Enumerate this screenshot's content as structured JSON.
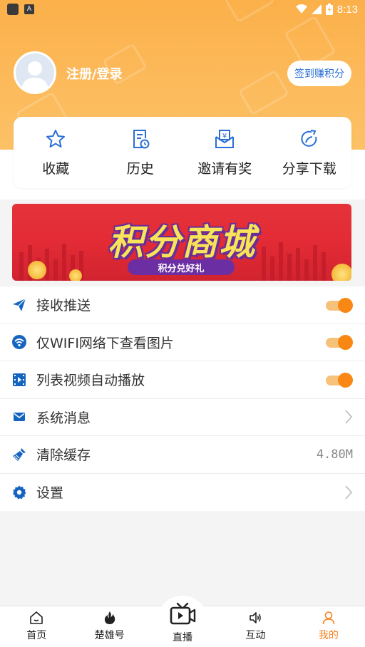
{
  "status_bar": {
    "time": "8:13"
  },
  "profile": {
    "login_text": "注册/登录",
    "checkin_button": "签到赚积分"
  },
  "quick_actions": [
    {
      "label": "收藏",
      "icon": "star-icon"
    },
    {
      "label": "历史",
      "icon": "history-icon"
    },
    {
      "label": "邀请有奖",
      "icon": "invite-icon"
    },
    {
      "label": "分享下载",
      "icon": "share-icon"
    }
  ],
  "banner": {
    "title": "积分商城",
    "subtitle": "积分兑好礼"
  },
  "settings": [
    {
      "label": "接收推送",
      "icon": "send-icon",
      "control": "toggle",
      "on": true
    },
    {
      "label": "仅WIFI网络下查看图片",
      "icon": "wifi-icon",
      "control": "toggle",
      "on": true
    },
    {
      "label": "列表视频自动播放",
      "icon": "video-icon",
      "control": "toggle",
      "on": true
    },
    {
      "label": "系统消息",
      "icon": "mail-icon",
      "control": "chevron"
    },
    {
      "label": "清除缓存",
      "icon": "broom-icon",
      "control": "value",
      "value": "4.80M"
    },
    {
      "label": "设置",
      "icon": "gear-icon",
      "control": "chevron"
    }
  ],
  "bottom_nav": [
    {
      "label": "首页",
      "icon": "home-icon"
    },
    {
      "label": "楚雄号",
      "icon": "fire-icon"
    },
    {
      "label": "直播",
      "icon": "live-tv-icon"
    },
    {
      "label": "互动",
      "icon": "speaker-icon"
    },
    {
      "label": "我的",
      "icon": "user-icon",
      "active": true
    }
  ],
  "colors": {
    "accent": "#f98714",
    "header": "#fbb04a",
    "link_blue": "#2a6fd6",
    "icon_blue": "#1565c0"
  }
}
